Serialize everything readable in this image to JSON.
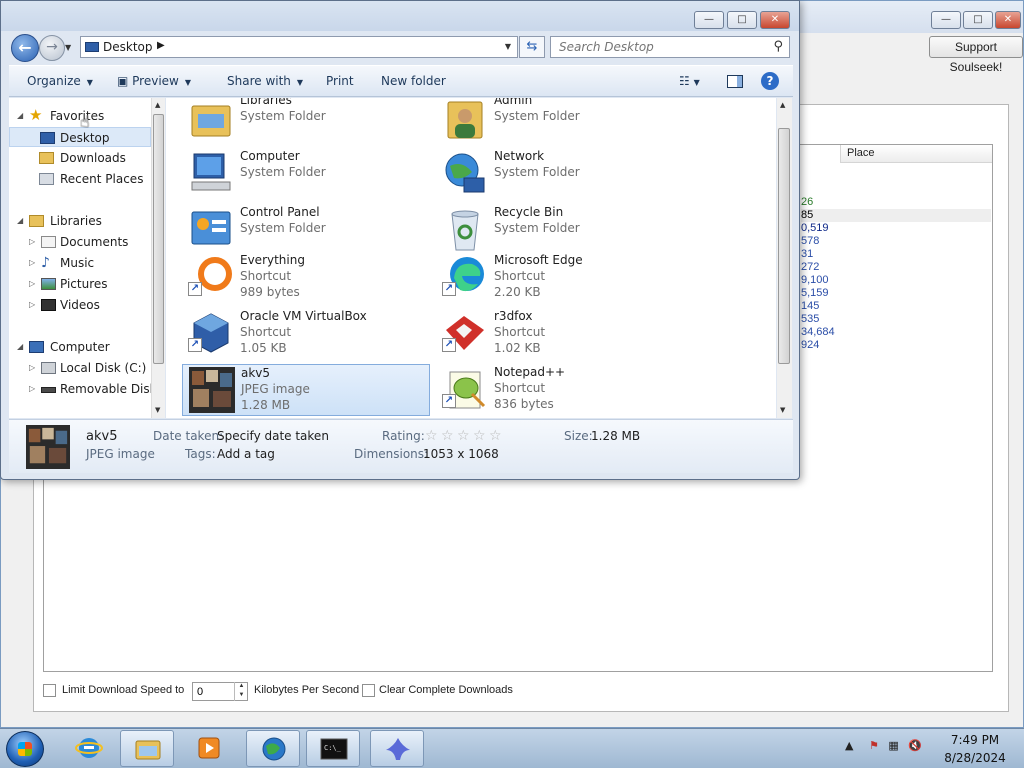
{
  "background_app": {
    "support_button": "Support Soulseek!",
    "column_header": "Place",
    "places": [
      "26",
      "85",
      "0,519",
      "578",
      "31",
      "272",
      "9,100",
      "5,159",
      "145",
      "535",
      "34,684",
      "924"
    ],
    "limit_speed_label": "Limit Download Speed to",
    "speed_value": "0",
    "speed_unit": "Kilobytes Per Second",
    "clear_label": "Clear Complete Downloads"
  },
  "explorer": {
    "address": "Desktop",
    "search_placeholder": "Search Desktop",
    "toolbar": {
      "organize": "Organize",
      "preview": "Preview",
      "share_with": "Share with",
      "print": "Print",
      "new_folder": "New folder"
    },
    "nav": [
      {
        "label": "Favorites",
        "icon": "star-icon",
        "level": 0,
        "expanded": true
      },
      {
        "label": "Desktop",
        "icon": "desktop-icon",
        "level": 1,
        "selected": true
      },
      {
        "label": "Downloads",
        "icon": "downloads-folder-icon",
        "level": 1
      },
      {
        "label": "Recent Places",
        "icon": "recent-places-icon",
        "level": 1
      },
      {
        "label": "Libraries",
        "icon": "libraries-icon",
        "level": 0,
        "expanded": true
      },
      {
        "label": "Documents",
        "icon": "documents-icon",
        "level": 1
      },
      {
        "label": "Music",
        "icon": "music-icon",
        "level": 1
      },
      {
        "label": "Pictures",
        "icon": "pictures-icon",
        "level": 1
      },
      {
        "label": "Videos",
        "icon": "videos-icon",
        "level": 1
      },
      {
        "label": "Computer",
        "icon": "computer-icon",
        "level": 0,
        "expanded": true
      },
      {
        "label": "Local Disk (C:)",
        "icon": "disk-icon",
        "level": 1
      },
      {
        "label": "Removable Disk (",
        "icon": "removable-disk-icon",
        "level": 1
      }
    ],
    "files": [
      {
        "name": "Libraries",
        "type": "System Folder",
        "size": "",
        "icon": "libraries-icon"
      },
      {
        "name": "Admin",
        "type": "System Folder",
        "size": "",
        "icon": "user-folder-icon"
      },
      {
        "name": "Computer",
        "type": "System Folder",
        "size": "",
        "icon": "computer-icon"
      },
      {
        "name": "Network",
        "type": "System Folder",
        "size": "",
        "icon": "network-icon"
      },
      {
        "name": "Control Panel",
        "type": "System Folder",
        "size": "",
        "icon": "control-panel-icon"
      },
      {
        "name": "Recycle Bin",
        "type": "System Folder",
        "size": "",
        "icon": "recycle-bin-icon"
      },
      {
        "name": "Everything",
        "type": "Shortcut",
        "size": "989 bytes",
        "icon": "everything-icon",
        "shortcut": true
      },
      {
        "name": "Microsoft Edge",
        "type": "Shortcut",
        "size": "2.20 KB",
        "icon": "edge-icon",
        "shortcut": true
      },
      {
        "name": "Oracle VM VirtualBox",
        "type": "Shortcut",
        "size": "1.05 KB",
        "icon": "virtualbox-icon",
        "shortcut": true
      },
      {
        "name": "r3dfox",
        "type": "Shortcut",
        "size": "1.02 KB",
        "icon": "r3dfox-icon",
        "shortcut": true
      },
      {
        "name": "akv5",
        "type": "JPEG image",
        "size": "1.28 MB",
        "icon": "jpeg-thumbnail-icon",
        "selected": true
      },
      {
        "name": "Notepad++",
        "type": "Shortcut",
        "size": "836 bytes",
        "icon": "notepadpp-icon",
        "shortcut": true
      }
    ],
    "details": {
      "name": "akv5",
      "type": "JPEG image",
      "date_label": "Date taken:",
      "date_value": "Specify date taken",
      "tags_label": "Tags:",
      "tags_value": "Add a tag",
      "rating_label": "Rating:",
      "dimensions_label": "Dimensions:",
      "dimensions_value": "1053 x 1068",
      "size_label": "Size:",
      "size_value": "1.28 MB"
    }
  },
  "taskbar": {
    "time": "7:49 PM",
    "date": "8/28/2024",
    "apps": [
      "internet-explorer-icon",
      "file-explorer-icon",
      "media-player-icon",
      "network-globe-icon",
      "command-prompt-icon",
      "soulseek-icon"
    ]
  }
}
